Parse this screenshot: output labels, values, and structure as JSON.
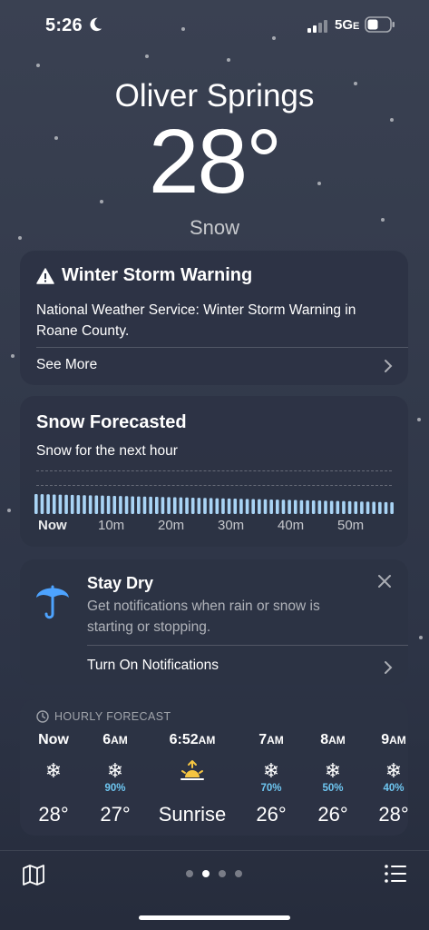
{
  "status_bar": {
    "time": "5:26",
    "network": "5G",
    "network_suffix": "E"
  },
  "header": {
    "city": "Oliver Springs",
    "temperature": "28°",
    "condition": "Snow"
  },
  "warning": {
    "title": "Winter Storm Warning",
    "text": "National Weather Service: Winter Storm Warning in Roane County.",
    "link": "See More",
    "icon": "warning-triangle-icon"
  },
  "snow_forecast": {
    "title": "Snow Forecasted",
    "subtitle": "Snow for the next hour",
    "ticks": [
      "Now",
      "10m",
      "20m",
      "30m",
      "40m",
      "50m"
    ]
  },
  "stay_dry": {
    "title": "Stay Dry",
    "text": "Get notifications when rain or snow is starting or stopping.",
    "action": "Turn On Notifications",
    "icon": "umbrella-icon",
    "accent": "#4da3ff"
  },
  "hourly": {
    "header": "HOURLY FORECAST",
    "items": [
      {
        "time": "Now",
        "suffix": "",
        "icon": "snowflake-icon",
        "glyph": "❄",
        "pop": "",
        "temp": "28°"
      },
      {
        "time": "6",
        "suffix": "AM",
        "icon": "snowflake-icon",
        "glyph": "❄",
        "pop": "90%",
        "temp": "27°"
      },
      {
        "time": "6:52",
        "suffix": "AM",
        "icon": "sunrise-icon",
        "glyph": "",
        "pop": "",
        "temp": "Sunrise"
      },
      {
        "time": "7",
        "suffix": "AM",
        "icon": "snowflake-icon",
        "glyph": "❄",
        "pop": "70%",
        "temp": "26°"
      },
      {
        "time": "8",
        "suffix": "AM",
        "icon": "snowflake-icon",
        "glyph": "❄",
        "pop": "50%",
        "temp": "26°"
      },
      {
        "time": "9",
        "suffix": "AM",
        "icon": "snowflake-icon",
        "glyph": "❄",
        "pop": "40%",
        "temp": "28°"
      }
    ]
  },
  "colors": {
    "precip_bar": "#a9d4f5",
    "pop_text": "#6ec6f1"
  },
  "bottom_bar": {
    "page_count": 4,
    "active_page": 1
  }
}
